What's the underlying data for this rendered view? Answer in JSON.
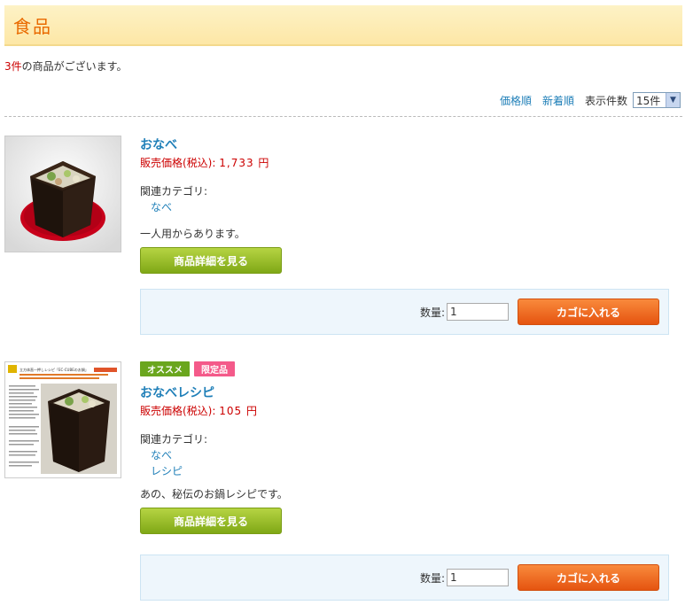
{
  "page": {
    "title": "食品",
    "count_number": "3件",
    "count_suffix": "の商品がございます。"
  },
  "sort": {
    "by_price": "価格順",
    "by_new": "新着順",
    "per_page_label": "表示件数",
    "per_page_value": "15件"
  },
  "products": [
    {
      "badges": [],
      "name": "おなべ",
      "price_label": "販売価格(税込):",
      "price_value": "1,733 円",
      "category_label": "関連カテゴリ:",
      "categories": [
        "なべ"
      ],
      "description": "一人用からあります。",
      "detail_button": "商品詳細を見る",
      "qty_label": "数量:",
      "qty_value": "1",
      "cart_button": "カゴに入れる"
    },
    {
      "badges": [
        "オススメ",
        "限定品"
      ],
      "name": "おなべレシピ",
      "price_label": "販売価格(税込):",
      "price_value": "105 円",
      "category_label": "関連カテゴリ:",
      "categories": [
        "なべ",
        "レシピ"
      ],
      "description": "あの、秘伝のお鍋レシピです。",
      "detail_button": "商品詳細を見る",
      "qty_label": "数量:",
      "qty_value": "1",
      "cart_button": "カゴに入れる"
    }
  ],
  "recipe_thumb": {
    "heading": "立方体直一押しレシピ「EC-CUBEのお鍋」"
  },
  "colors": {
    "accent": "#e96a00",
    "link": "#1f7fb8",
    "price": "#cc0000",
    "detail_button": "#8cb51f",
    "cart_button": "#ee6a20",
    "badge_recommend": "#6aa61e",
    "badge_limited": "#f45a8a"
  }
}
